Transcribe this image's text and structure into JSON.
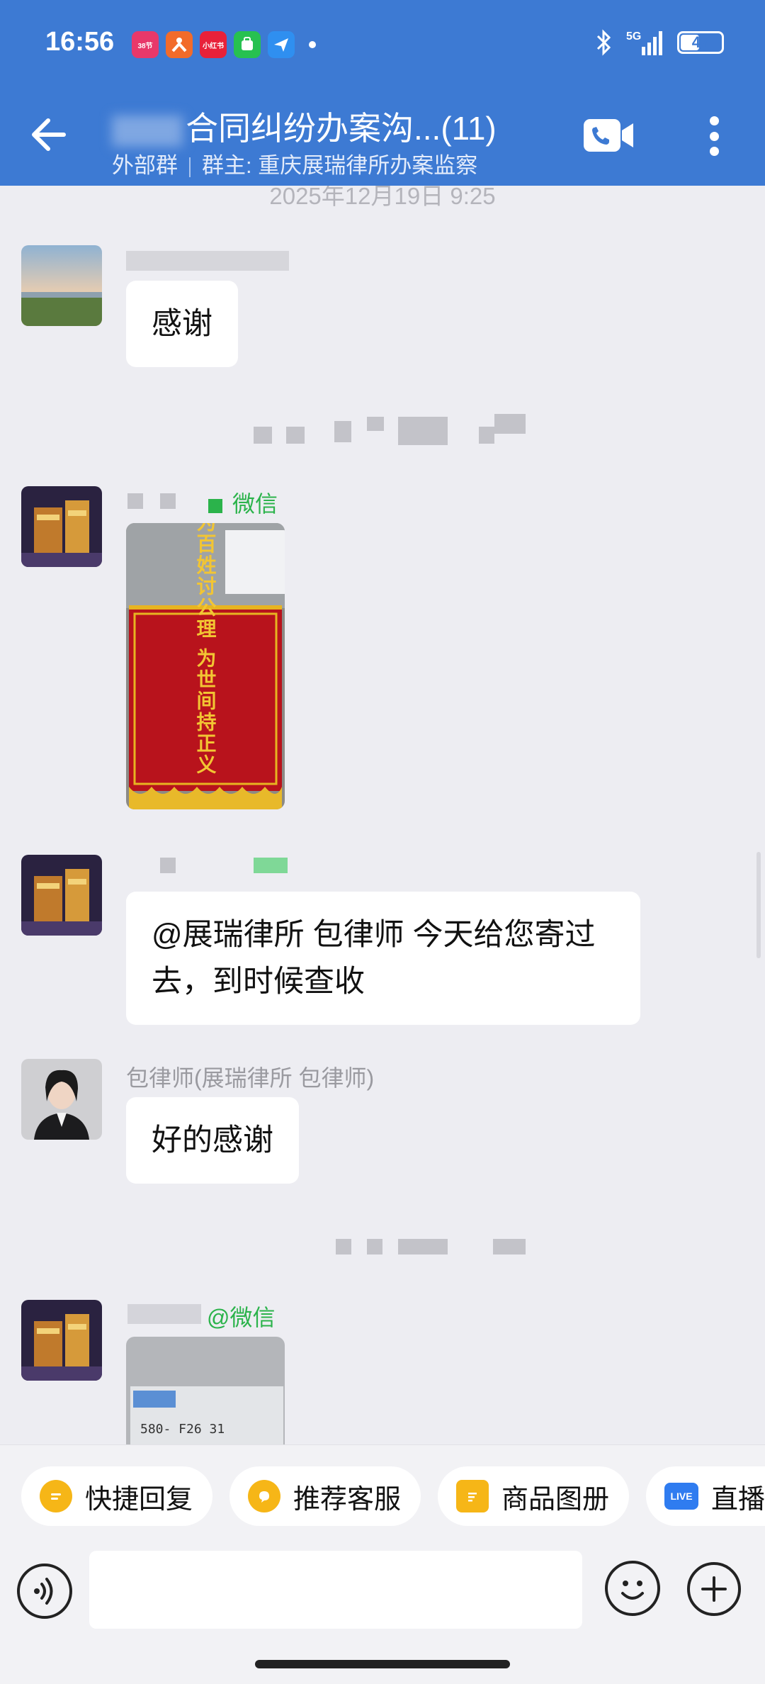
{
  "status_bar": {
    "time": "16:56",
    "network": "5G",
    "battery": "47",
    "notification_apps": [
      {
        "label": "38节",
        "color": "#e8386a"
      },
      {
        "label": "",
        "color": "#f26b2a"
      },
      {
        "label": "小红书",
        "color": "#e8213a"
      },
      {
        "label": "",
        "color": "#27c150"
      },
      {
        "label": "",
        "color": "#2f8ff0"
      }
    ]
  },
  "header": {
    "title": "合同纠纷办案沟...(11)",
    "subtitle_group": "外部群",
    "subtitle_owner": "群主: 重庆展瑞律所办案监察",
    "bg_color": "#3d7ad3"
  },
  "chat": {
    "timestamp_top": "2025年12月19日 9:25",
    "messages": [
      {
        "sender": "",
        "text": "感谢"
      },
      {
        "sender": "微信",
        "image_caption": "为百姓讨公理 为世间持正义"
      },
      {
        "sender": "",
        "text": "@展瑞律所 包律师 今天给您寄过去，到时候查收"
      },
      {
        "sender": "包律师(展瑞律所 包律师)",
        "text": "好的感谢"
      },
      {
        "sender": "@微信",
        "image_caption": "580- F26 31"
      }
    ]
  },
  "quick_actions": [
    {
      "label": "快捷回复",
      "icon": "quick-reply-icon",
      "color": "#f6b617"
    },
    {
      "label": "推荐客服",
      "icon": "recommend-service-icon",
      "color": "#f6b617"
    },
    {
      "label": "商品图册",
      "icon": "product-album-icon",
      "color": "#f6b617"
    },
    {
      "label": "直播",
      "icon": "live-icon",
      "color": "#2f7cf0",
      "badge": "LIVE"
    }
  ],
  "input": {
    "placeholder": ""
  }
}
